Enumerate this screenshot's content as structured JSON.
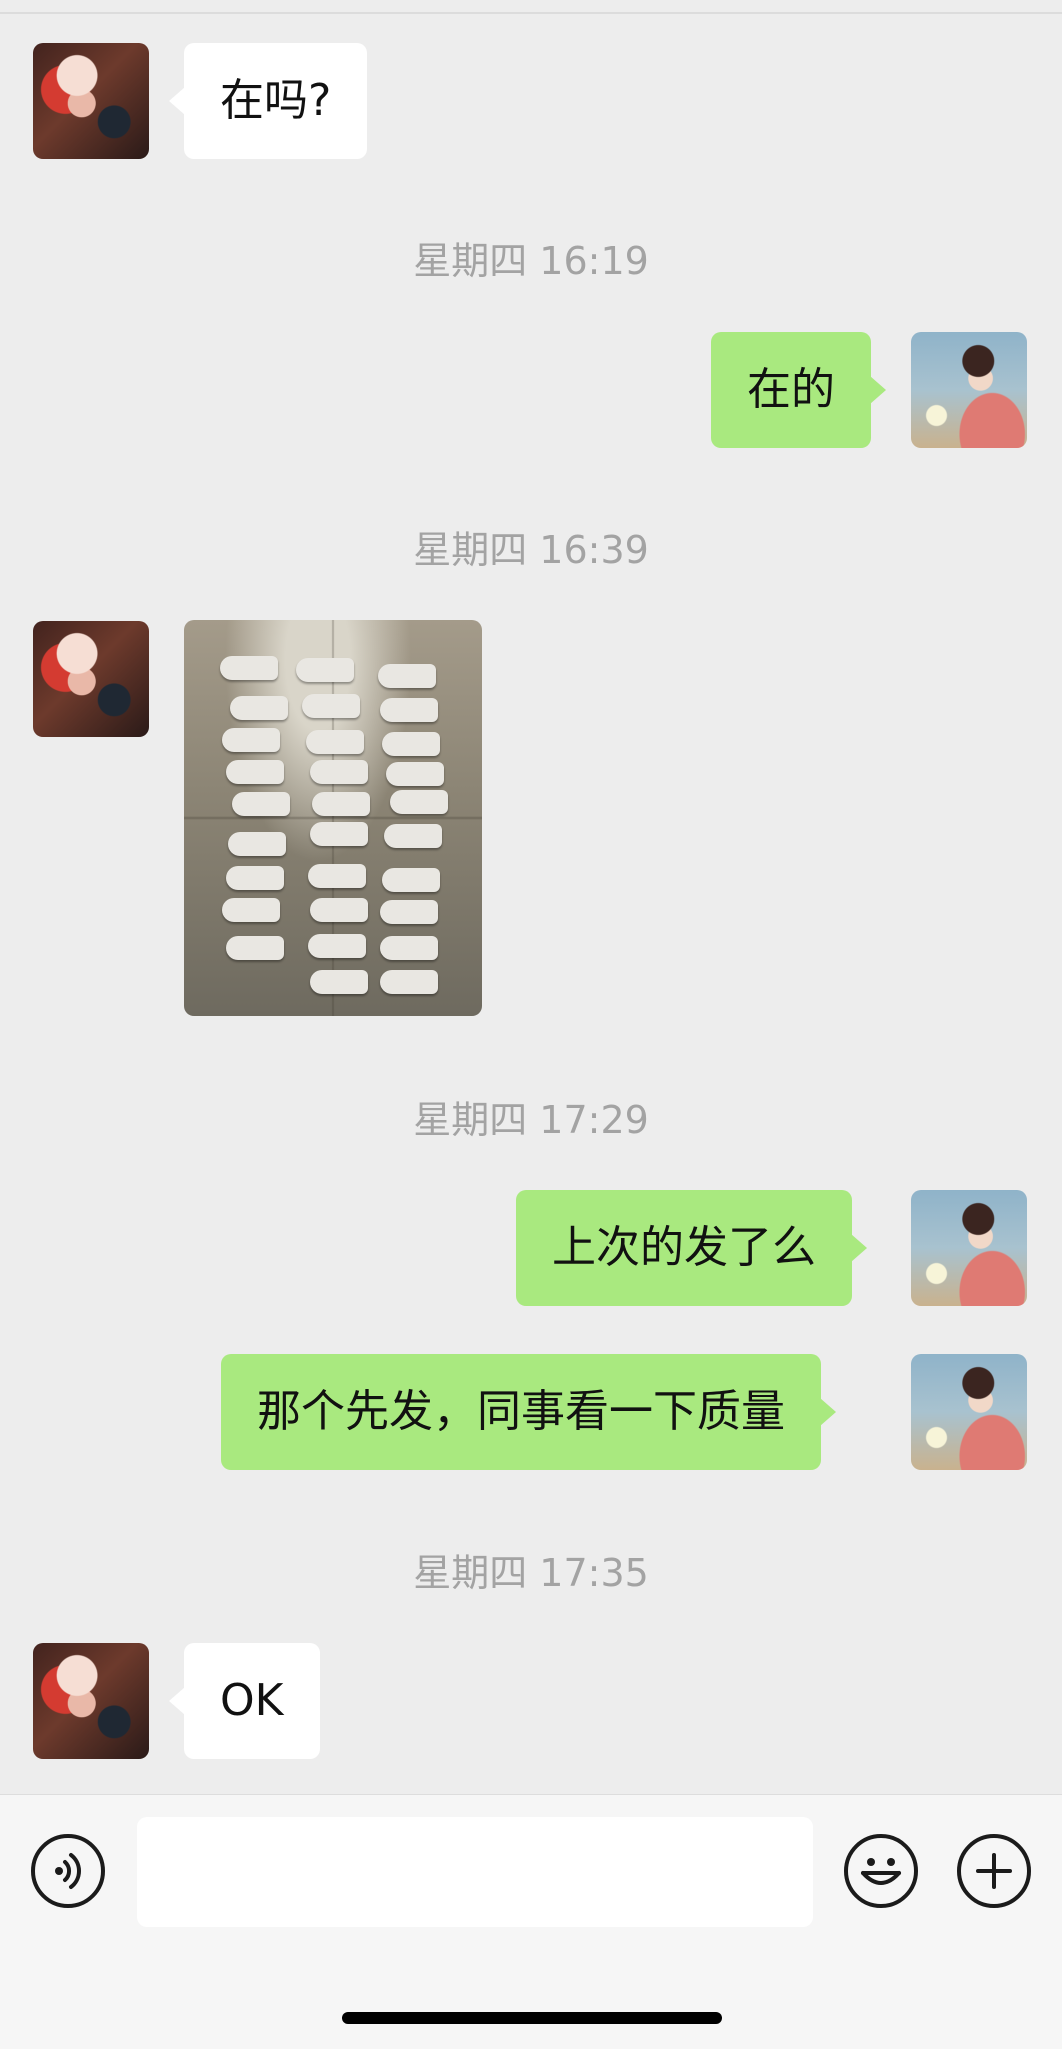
{
  "messages": [
    {
      "side": "in",
      "text": "在吗?"
    },
    {
      "timestamp": "星期四 16:19"
    },
    {
      "side": "out",
      "text": "在的"
    },
    {
      "timestamp": "星期四 16:39"
    },
    {
      "side": "in",
      "type": "image"
    },
    {
      "timestamp": "星期四 17:29"
    },
    {
      "side": "out",
      "text": "上次的发了么"
    },
    {
      "side": "out",
      "text": "那个先发，同事看一下质量"
    },
    {
      "timestamp": "星期四 17:35"
    },
    {
      "side": "in",
      "text": "OK"
    }
  ],
  "input_bar": {
    "left_icon": "voice-icon",
    "right_icons": [
      "emoji-icon",
      "plus-icon"
    ],
    "input_value": ""
  },
  "colors": {
    "background": "#ededed",
    "incoming_bubble": "#ffffff",
    "outgoing_bubble": "#a9e97f",
    "timestamp_text": "#a3a3a3"
  }
}
